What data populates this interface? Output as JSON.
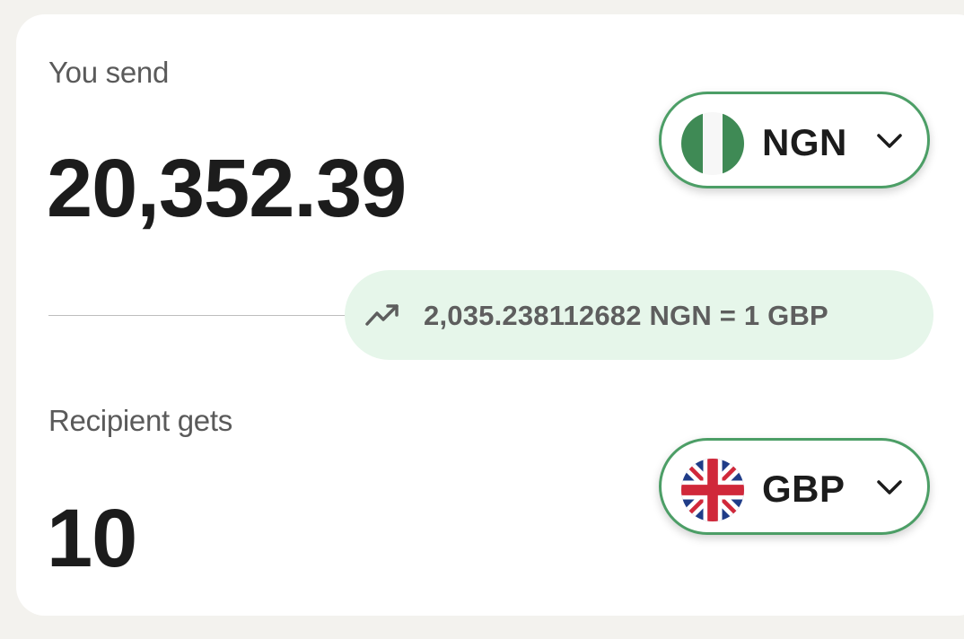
{
  "send": {
    "label": "You send",
    "amount": "20,352.39",
    "currency": {
      "code": "NGN",
      "flag_icon": "nigeria-flag-icon",
      "dropdown_icon": "chevron-down-icon"
    }
  },
  "rate": {
    "icon": "trending-up-icon",
    "text": "2,035.238112682 NGN = 1 GBP",
    "background_color": "#e6f6ea"
  },
  "receive": {
    "label": "Recipient gets",
    "amount": "10",
    "currency": {
      "code": "GBP",
      "flag_icon": "uk-flag-icon",
      "dropdown_icon": "chevron-down-icon"
    }
  },
  "colors": {
    "accent": "#4c9e66",
    "text_primary": "#1c1c1c",
    "text_secondary": "#5a5a5a",
    "page_background": "#f3f2ee",
    "card_background": "#ffffff"
  }
}
